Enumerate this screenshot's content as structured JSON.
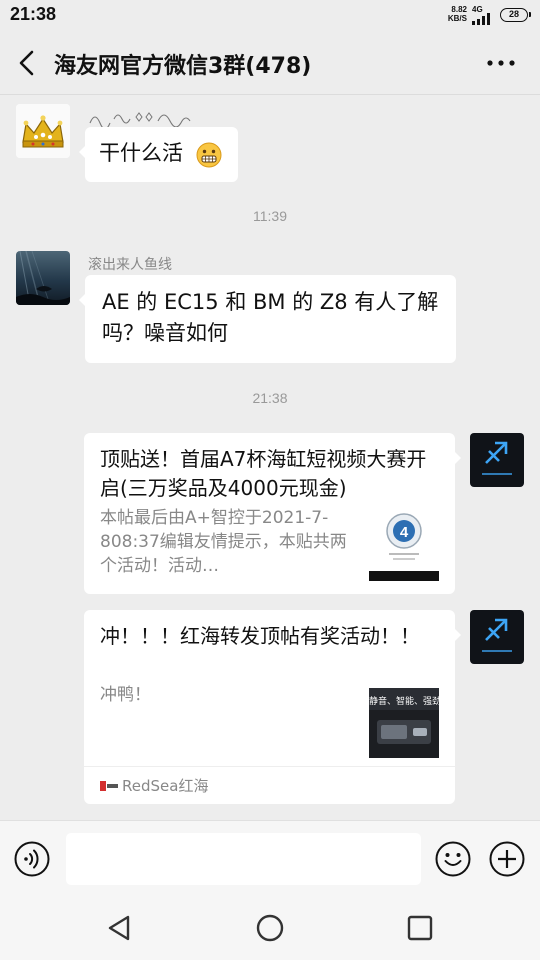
{
  "status_bar": {
    "time": "21:38",
    "speed_value": "8.82",
    "speed_unit": "KB/S",
    "network": "4G",
    "battery": "28"
  },
  "header": {
    "title": "海友网官方微信3群(478)",
    "back_icon": "chevron-left-icon",
    "more_icon": "more-horizontal-icon"
  },
  "messages": [
    {
      "type": "text",
      "side": "left",
      "sender": "",
      "avatar_icon": "crown-avatar",
      "text": "干什么活",
      "emoji": "grimacing-face-emoji"
    },
    {
      "type": "time",
      "text": "11:39"
    },
    {
      "type": "text",
      "side": "left",
      "sender": "滚出来人鱼线",
      "avatar_icon": "aquarium-avatar",
      "line1": "AE 的 EC15 和 BM 的 Z8 有人了解",
      "line2": "吗？噪音如何"
    },
    {
      "type": "time",
      "text": "21:38"
    },
    {
      "type": "link_card",
      "side": "right",
      "avatar_icon": "sagittarius-avatar",
      "title": "顶贴送！首届A7杯海缸短视频大赛开启(三万奖品及4000元现金)",
      "desc": "本帖最后由A+智控于2021-7-808:37编辑友情提示，本贴共两个活动！活动…"
    },
    {
      "type": "link_card",
      "side": "right",
      "avatar_icon": "sagittarius-avatar",
      "title": "冲！！！红海转发顶帖有奖活动！！",
      "desc": "冲鸭！",
      "thumb_text": "静音、智能、强劲",
      "source": "RedSea红海"
    }
  ],
  "input_bar": {
    "placeholder": "",
    "voice_icon": "voice-icon",
    "emoji_icon": "emoji-icon",
    "plus_icon": "plus-icon"
  },
  "nav_bar": {
    "back_icon": "nav-back-icon",
    "home_icon": "nav-home-icon",
    "recent_icon": "nav-recent-icon"
  },
  "colors": {
    "background": "#ededed",
    "bubble": "#ffffff",
    "timestamp": "#999999",
    "sender_name": "#888888"
  }
}
